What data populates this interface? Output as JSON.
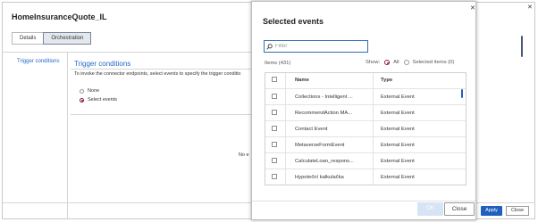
{
  "app": {
    "title": "HomeInsuranceQuote_IL"
  },
  "tabs": [
    {
      "label": "Details",
      "active": false
    },
    {
      "label": "Orchestration",
      "active": true
    }
  ],
  "left_nav": {
    "label": "Trigger conditions"
  },
  "section": {
    "title": "Trigger conditions",
    "description": "To invoke the connector endpoints, select events to specify the trigger conditio",
    "radio_none": "None",
    "radio_select": "Select events"
  },
  "background": {
    "clipped_text": "No e",
    "apply_label": "Apply",
    "close_label": "Close"
  },
  "dialog": {
    "title": "Selected events",
    "filter_placeholder": "Filter",
    "items_count": "Items (431)",
    "show_label": "Show:",
    "show_all": "All",
    "show_selected": "Selected items (0)",
    "columns": {
      "name": "Name",
      "type": "Type"
    },
    "rows": [
      {
        "name": "Collections - Intelligent ...",
        "type": "External Event"
      },
      {
        "name": "RecommendAction MA...",
        "type": "External Event"
      },
      {
        "name": "Contact Event",
        "type": "External Event"
      },
      {
        "name": "MetaverseFormEvent",
        "type": "External Event"
      },
      {
        "name": "CalculateLoan_respons...",
        "type": "External Event"
      },
      {
        "name": "Hypoteční kalkulačka",
        "type": "External Event"
      }
    ],
    "ok_label": "OK",
    "close_label": "Close"
  },
  "colors": {
    "accent": "#2469c8",
    "primary_button": "#1f5fbf",
    "radio_selected": "#8a1b45"
  }
}
